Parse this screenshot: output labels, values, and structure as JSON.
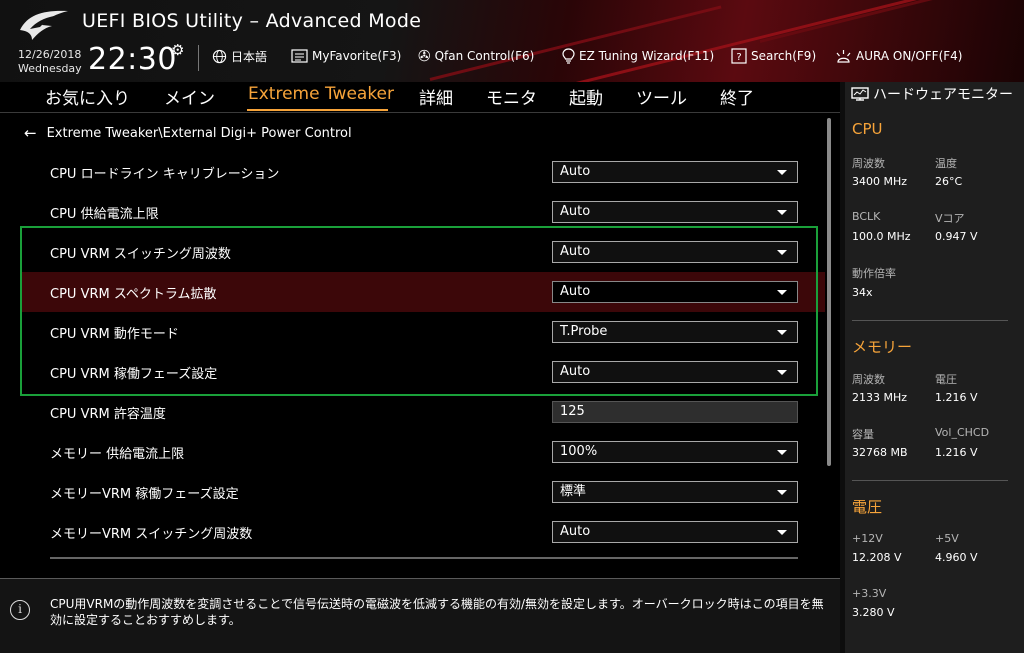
{
  "header": {
    "title": "UEFI BIOS Utility – Advanced Mode",
    "date": "12/26/2018",
    "weekday": "Wednesday",
    "time": "22:30",
    "buttons": [
      {
        "icon": "globe-icon",
        "label": "日本語"
      },
      {
        "icon": "myfavorite-icon",
        "label": "MyFavorite(F3)"
      },
      {
        "icon": "fan-icon",
        "label": "Qfan Control(F6)"
      },
      {
        "icon": "lightbulb-icon",
        "label": "EZ Tuning Wizard(F11)"
      },
      {
        "icon": "search-icon",
        "label": "Search(F9)"
      },
      {
        "icon": "aura-icon",
        "label": "AURA ON/OFF(F4)"
      }
    ]
  },
  "tabs": [
    "お気に入り",
    "メイン",
    "Extreme Tweaker",
    "詳細",
    "モニタ",
    "起動",
    "ツール",
    "終了"
  ],
  "active_tab": "Extreme Tweaker",
  "breadcrumb": "Extreme Tweaker\\External Digi+ Power Control",
  "settings": [
    {
      "label": "CPU ロードライン キャリブレーション",
      "value": "Auto",
      "type": "select"
    },
    {
      "label": "CPU 供給電流上限",
      "value": "Auto",
      "type": "select"
    },
    {
      "label": "CPU VRM スイッチング周波数",
      "value": "Auto",
      "type": "select"
    },
    {
      "label": "CPU VRM スペクトラム拡散",
      "value": "Auto",
      "type": "select"
    },
    {
      "label": "CPU VRM 動作モード",
      "value": "T.Probe",
      "type": "select"
    },
    {
      "label": "CPU VRM 稼働フェーズ設定",
      "value": "Auto",
      "type": "select"
    },
    {
      "label": "CPU VRM 許容温度",
      "value": "125",
      "type": "input"
    },
    {
      "label": "メモリー 供給電流上限",
      "value": "100%",
      "type": "select"
    },
    {
      "label": "メモリーVRM 稼働フェーズ設定",
      "value": "標準",
      "type": "select"
    },
    {
      "label": "メモリーVRM スイッチング周波数",
      "value": "Auto",
      "type": "select"
    }
  ],
  "help_text": "CPU用VRMの動作周波数を変調させることで信号伝送時の電磁波を低減する機能の有効/無効を設定します。オーバークロック時はこの項目を無効に設定することおすすめします。",
  "monitor": {
    "title": "ハードウェアモニター",
    "cpu": {
      "title": "CPU",
      "freq_label": "周波数",
      "freq": "3400 MHz",
      "temp_label": "温度",
      "temp": "26°C",
      "bclk_label": "BCLK",
      "bclk": "100.0 MHz",
      "vcore_label": "Vコア",
      "vcore": "0.947 V",
      "ratio_label": "動作倍率",
      "ratio": "34x"
    },
    "memory": {
      "title": "メモリー",
      "freq_label": "周波数",
      "freq": "2133 MHz",
      "volt_label": "電圧",
      "volt": "1.216 V",
      "cap_label": "容量",
      "cap": "32768 MB",
      "vol_chcd_label": "Vol_CHCD",
      "vol_chcd": "1.216 V"
    },
    "voltage": {
      "title": "電圧",
      "v12_label": "+12V",
      "v12": "12.208 V",
      "v5_label": "+5V",
      "v5": "4.960 V",
      "v33_label": "+3.3V",
      "v33": "3.280 V"
    }
  },
  "colors": {
    "accent": "#f7a43a",
    "highlight_row": "#3c0709",
    "annotation_box": "#1aa03a"
  }
}
